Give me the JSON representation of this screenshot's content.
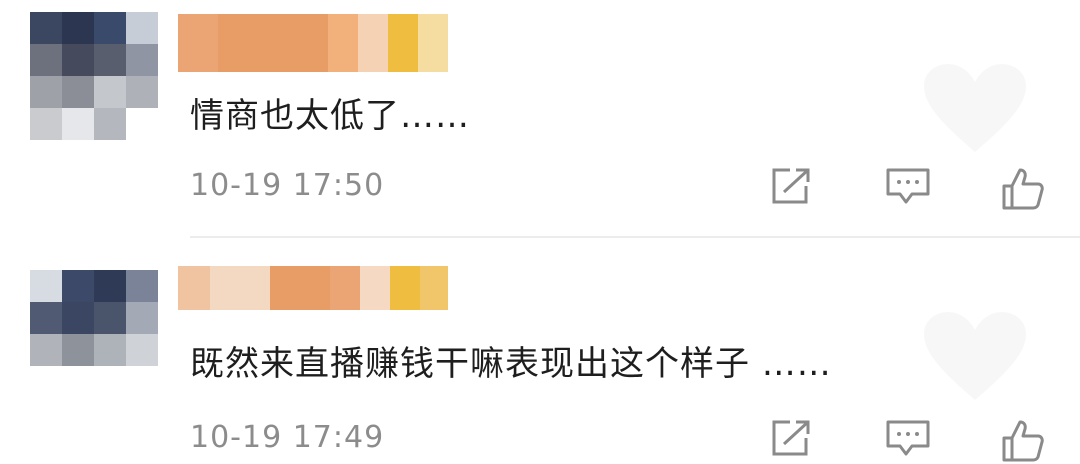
{
  "comments": [
    {
      "content": "情商也太低了……",
      "timestamp": "10-19 17:50",
      "actions": {
        "share": "share-icon",
        "reply": "comment-icon",
        "like": "thumbs-up-icon"
      }
    },
    {
      "content": "既然来直播赚钱干嘛表现出这个样子 ……",
      "timestamp": "10-19 17:49",
      "actions": {
        "share": "share-icon",
        "reply": "comment-icon",
        "like": "thumbs-up-icon"
      }
    }
  ],
  "colors": {
    "text": "#1e1e1e",
    "timestamp": "#8c8c8c",
    "icon": "#8a8a8a",
    "blur_orange": "#e9a06a",
    "blur_yellow": "#efbd3f",
    "blur_navy": "#2c3650"
  }
}
